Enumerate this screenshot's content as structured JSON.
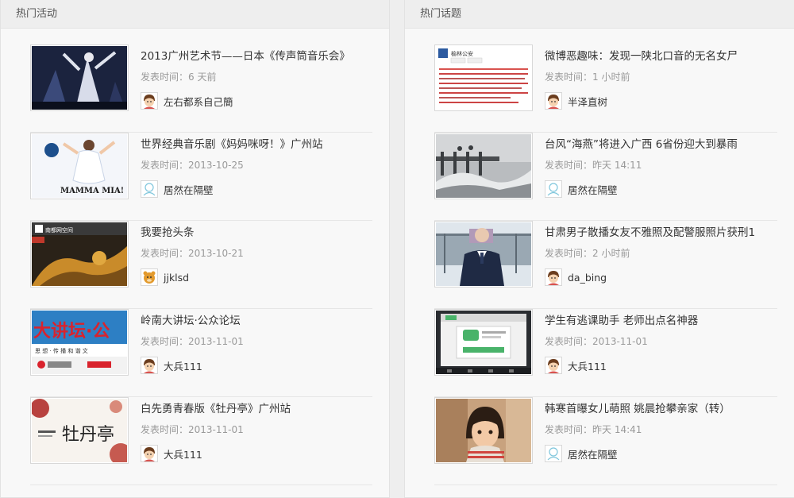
{
  "left_panel": {
    "title": "热门活动",
    "items": [
      {
        "title": "2013广州艺术节——日本《传声筒音乐会》",
        "time_prefix": "发表时间：",
        "time": "6 天前",
        "author": "左右都系自己簡",
        "avatar": "boy-avatar",
        "thumb": "concert-photo"
      },
      {
        "title": "世界经典音乐剧《妈妈咪呀！》广州站",
        "time_prefix": "发表时间：",
        "time": "2013-10-25",
        "author": "居然在隔壁",
        "avatar": "default-avatar",
        "thumb": "mamma-mia-poster",
        "thumb_text": "MAMMA MIA!"
      },
      {
        "title": "我要抢头条",
        "time_prefix": "发表时间：",
        "time": "2013-10-21",
        "author": "jjklsd",
        "avatar": "cartoon-avatar",
        "thumb": "news-photo",
        "thumb_text": "南都网空间"
      },
      {
        "title": "岭南大讲坛·公众论坛",
        "time_prefix": "发表时间：",
        "time": "2013-11-01",
        "author": "大兵111",
        "avatar": "boy-avatar",
        "thumb": "lecture-banner",
        "thumb_text": "大讲坛·公",
        "thumb_subtext": "思 想 · 传 播 和 谐 文"
      },
      {
        "title": "白先勇青春版《牡丹亭》广州站",
        "time_prefix": "发表时间：",
        "time": "2013-11-01",
        "author": "大兵111",
        "avatar": "boy-avatar",
        "thumb": "opera-poster",
        "thumb_text": "牡丹亭"
      }
    ]
  },
  "right_panel": {
    "title": "热门话题",
    "items": [
      {
        "title": "微博恶趣味：发现一陕北口音的无名女尸",
        "time_prefix": "发表时间：",
        "time": "1 小时前",
        "author": "半泽直树",
        "avatar": "boy-avatar",
        "thumb": "weibo-screenshot",
        "thumb_text": "榆林公安"
      },
      {
        "title": "台风“海燕”将进入广西 6省份迎大到暴雨",
        "time_prefix": "发表时间：",
        "time": "昨天 14:11",
        "author": "居然在隔壁",
        "avatar": "default-avatar",
        "thumb": "typhoon-photo"
      },
      {
        "title": "甘肃男子散播女友不雅照及配警服照片获刑1",
        "time_prefix": "发表时间：",
        "time": "2 小时前",
        "author": "da_bing",
        "avatar": "boy-avatar",
        "thumb": "police-photo"
      },
      {
        "title": "学生有逃课助手 老师出点名神器",
        "time_prefix": "发表时间：",
        "time": "2013-11-01",
        "author": "大兵111",
        "avatar": "boy-avatar",
        "thumb": "app-screenshot"
      },
      {
        "title": "韩寒首曝女儿萌照 姚晨抢攀亲家（转）",
        "time_prefix": "发表时间：",
        "time": "昨天 14:41",
        "author": "居然在隔壁",
        "avatar": "default-avatar",
        "thumb": "girl-photo"
      }
    ]
  }
}
